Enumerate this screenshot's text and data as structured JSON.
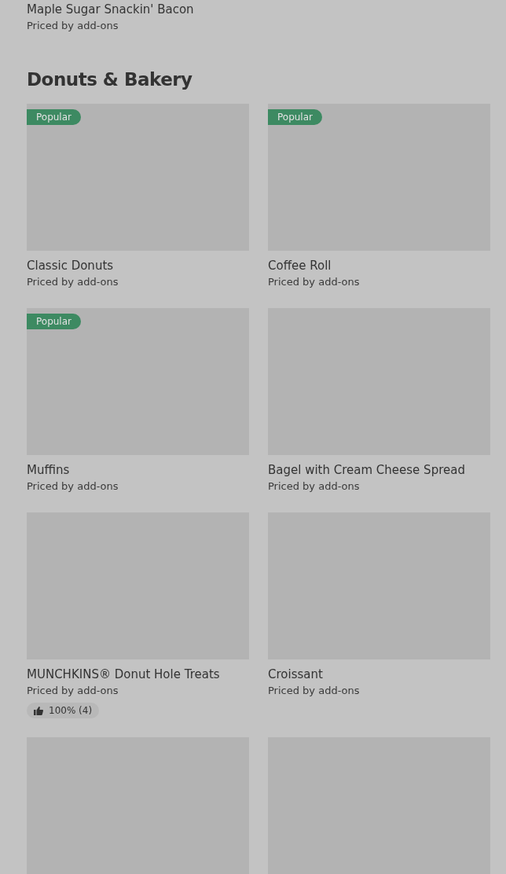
{
  "previous_item": {
    "name": "Maple Sugar Snackin' Bacon",
    "price": "Priced by add-ons"
  },
  "section": {
    "title": "Donuts & Bakery",
    "items": [
      {
        "kind": "product",
        "badge": "Popular",
        "name": "Classic Donuts",
        "price": "Priced by add-ons"
      },
      {
        "kind": "product",
        "badge": "Popular",
        "name": "Coffee Roll",
        "price": "Priced by add-ons"
      },
      {
        "kind": "product",
        "badge": "Popular",
        "name": "Muffins",
        "price": "Priced by add-ons"
      },
      {
        "kind": "product",
        "name": "Bagel with Cream Cheese Spread",
        "price": "Priced by add-ons"
      },
      {
        "kind": "product",
        "name": "MUNCHKINS® Donut Hole Treats",
        "price": "Priced by add-ons",
        "rating": "100% (4)"
      },
      {
        "kind": "product",
        "name": "Croissant",
        "price": "Priced by add-ons"
      },
      {
        "kind": "image_only"
      },
      {
        "kind": "image_only"
      }
    ]
  }
}
